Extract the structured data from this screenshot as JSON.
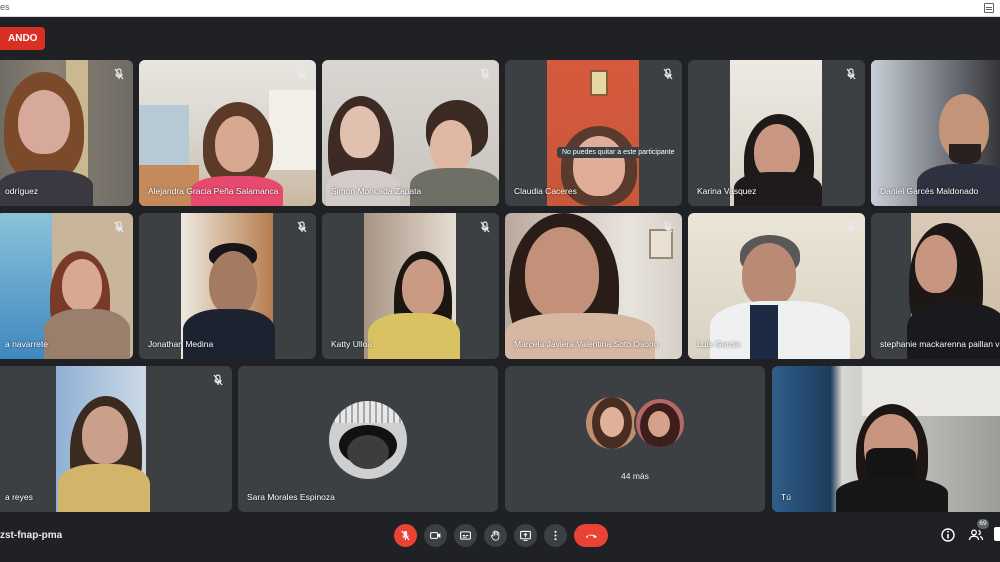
{
  "browser": {
    "tab_fragment": "es"
  },
  "recording": {
    "label": "ANDO"
  },
  "tooltip": {
    "text": "No puedes quitar a este participante"
  },
  "participants": [
    {
      "name": "odríguez",
      "muted": true
    },
    {
      "name": "Alejandra Gracia Peña Salamanca",
      "muted": true
    },
    {
      "name": "Simon Moncada Zapata",
      "muted": true
    },
    {
      "name": "Claudia Caceres",
      "muted": true
    },
    {
      "name": "Karina Vasquez",
      "muted": true
    },
    {
      "name": "Daniel Garcés Maldonado",
      "muted": false
    },
    {
      "name": "a navarrete",
      "muted": true
    },
    {
      "name": "Jonathan Medina",
      "muted": true
    },
    {
      "name": "Katty Ulloa",
      "muted": true
    },
    {
      "name": "Marcela Javiera Valentina Soto Osorio",
      "muted": true
    },
    {
      "name": "Luis Garcia",
      "muted": true
    },
    {
      "name": "stephanie mackarenna paillan v",
      "muted": false
    },
    {
      "name": "a reyes",
      "muted": true
    },
    {
      "name": "Sara Morales Espinoza",
      "muted": false
    },
    {
      "name": "Tú",
      "muted": false
    }
  ],
  "overflow": {
    "label": "44 más"
  },
  "meeting": {
    "code": "zst-fnap-pma"
  },
  "controls": {
    "mic_icon": "mic-off-icon",
    "camera_icon": "videocam-icon",
    "captions_icon": "closed-caption-icon",
    "hand_icon": "raise-hand-icon",
    "present_icon": "present-screen-icon",
    "more_icon": "more-vert-icon",
    "hangup_icon": "call-end-icon",
    "info_icon": "info-icon",
    "people_icon": "people-icon",
    "people_count": "69"
  },
  "colors": {
    "background": "#202124",
    "tile": "#3c4043",
    "danger": "#ea4335",
    "active_border": "#8ab4f8"
  }
}
